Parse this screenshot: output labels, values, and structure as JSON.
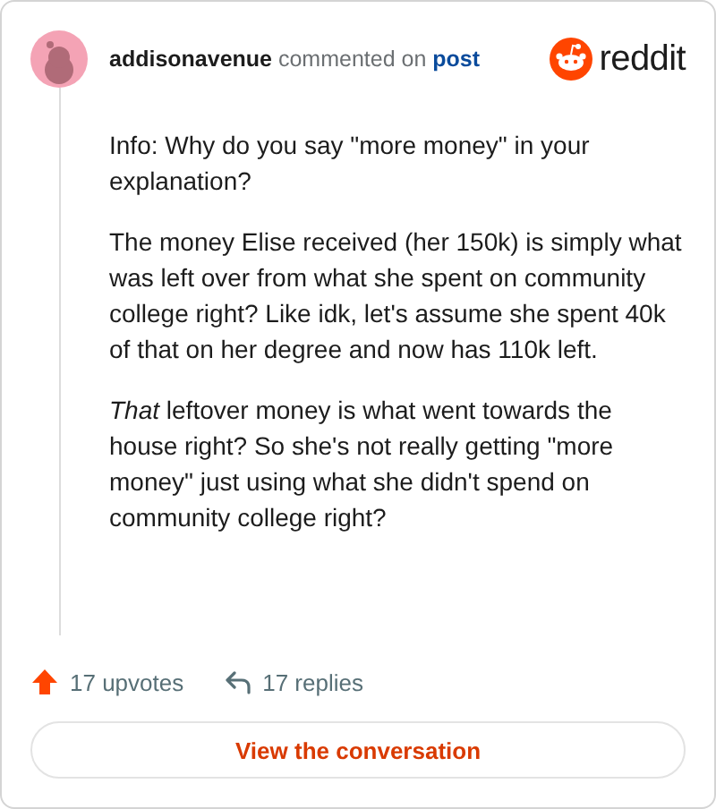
{
  "header": {
    "username": "addisonavenue",
    "action": "commented on",
    "link": "post",
    "brand": "reddit"
  },
  "comment": {
    "paragraphs": [
      "Info: Why do you say \"more money\" in your explanation?",
      "The money Elise received (her 150k) is simply what was left over from what she spent on community college right? Like idk, let's assume she spent 40k of that on her degree and now has 110k left.",
      "*That* leftover money is what went towards the house right? So she's not really getting \"more money\" just using what she didn't spend on community college right?"
    ]
  },
  "footer": {
    "upvotes": "17 upvotes",
    "replies": "17 replies"
  },
  "button": "View the conversation"
}
